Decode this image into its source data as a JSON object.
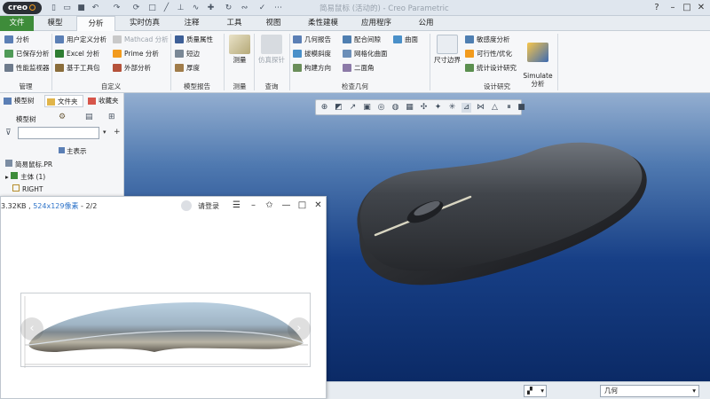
{
  "app": {
    "logo": "creo",
    "title": "简易鼠标 (活动的) - Creo Parametric"
  },
  "tabs": [
    "文件",
    "模型",
    "分析",
    "实时仿真",
    "注释",
    "工具",
    "视图",
    "柔性建模",
    "应用程序",
    "公用"
  ],
  "ribbon": {
    "manage": {
      "items": [
        "分析",
        "已保存分析",
        "性能监视器"
      ],
      "group": "管理"
    },
    "custom": {
      "items": [
        "用户定义分析",
        "Excel 分析",
        "基于工具包",
        "Mathcad 分析",
        "Prime 分析",
        "外部分析"
      ],
      "group": "自定义"
    },
    "model_report": {
      "items": [
        "质量属性",
        "短边",
        "厚度"
      ],
      "group": "模型报告"
    },
    "measure": {
      "label": "测量",
      "group": "测量"
    },
    "inquiry": {
      "label": "仿真探针",
      "group": "查询"
    },
    "check_geometry": {
      "items": [
        "几何报告",
        "拔模斜度",
        "构建方向",
        "配合间隙",
        "网格化曲面",
        "二面角",
        "曲面"
      ],
      "group": "检查几何"
    },
    "design_study": {
      "items": [
        "敏感度分析",
        "可行性/优化",
        "统计设计研究"
      ],
      "dim_boundary": "尺寸边界",
      "simulate": "Simulate\n分析",
      "group": "设计研究"
    }
  },
  "left_panel": {
    "tabs": [
      "模型树",
      "文件夹",
      "收藏夹"
    ],
    "model_tree_label": "模型树",
    "filter_placeholder": "",
    "main_display": "主表示",
    "tree": [
      "简易鼠标.PR",
      "主体 (1)",
      "RIGHT"
    ]
  },
  "status": {
    "selection_mode": "",
    "filter_value": "几何"
  },
  "viewer": {
    "info_prefix": "3.32KB , ",
    "info_dims": "524x129像素",
    "info_suffix": " - 2/2",
    "login": "请登录",
    "prev": "‹",
    "next": "›"
  },
  "colors": {
    "file_tab": "#3e8c3a",
    "viewport_top": "#93aed0",
    "viewport_bottom": "#0b2a66",
    "accent_orange": "#f29b1d"
  }
}
